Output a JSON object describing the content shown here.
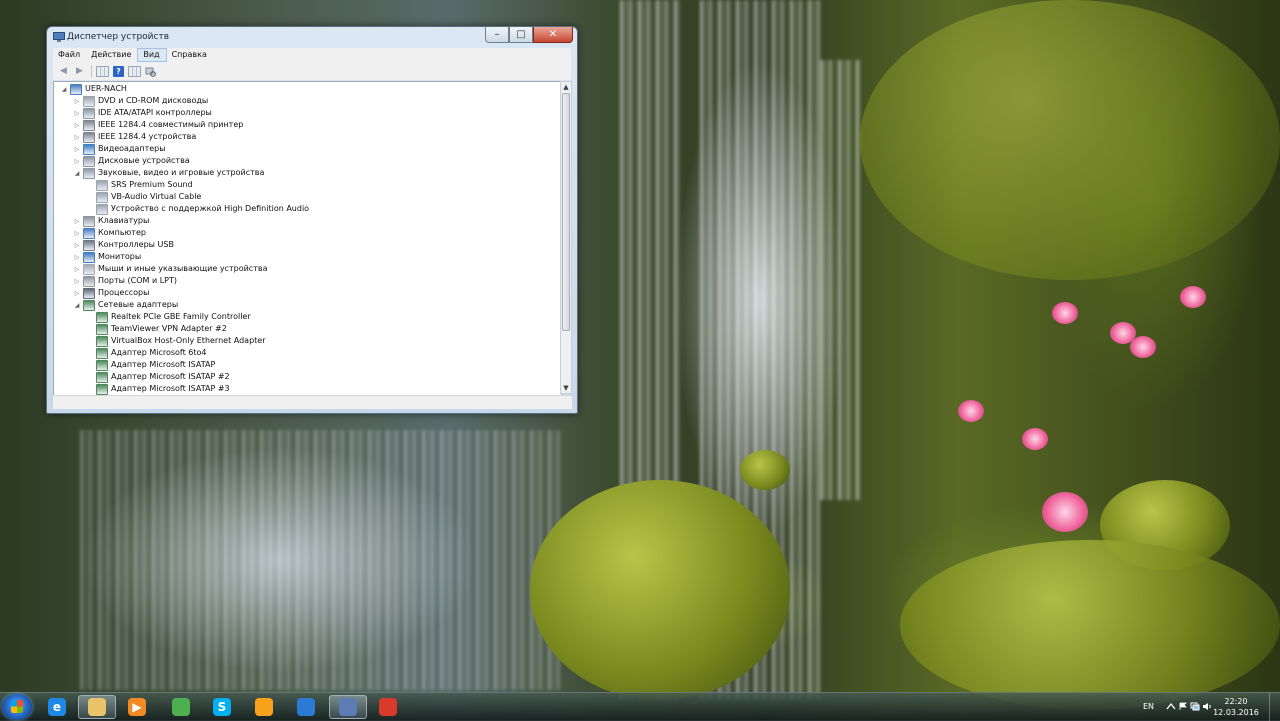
{
  "window": {
    "title": "Диспетчер устройств",
    "buttons": {
      "minimize": "–",
      "maximize": "□",
      "close": "✕"
    }
  },
  "menu": {
    "items": [
      {
        "label": "Файл"
      },
      {
        "label": "Действие"
      },
      {
        "label": "Вид"
      },
      {
        "label": "Справка"
      }
    ],
    "highlighted": "Вид"
  },
  "toolbar": {
    "buttons": [
      "back-arrow-icon",
      "forward-arrow-icon",
      "properties-grid-icon",
      "help-icon",
      "view-grid-icon",
      "scan-hardware-icon"
    ],
    "help_glyph": "?"
  },
  "tree": {
    "expander_glyphs": {
      "collapsed": "▷",
      "expanded": "◢"
    },
    "items": [
      {
        "label": "UER-NACH",
        "level": 0,
        "expander": "expanded",
        "icon": "computer-icon",
        "color": "#4a7fc1"
      },
      {
        "label": "DVD и CD-ROM дисководы",
        "level": 1,
        "expander": "collapsed",
        "icon": "dvd-drive-icon",
        "color": "#9aa3ad"
      },
      {
        "label": "IDE ATA/ATAPI контроллеры",
        "level": 1,
        "expander": "collapsed",
        "icon": "ide-controller-icon",
        "color": "#8a96a3"
      },
      {
        "label": "IEEE 1284.4 совместимый принтер",
        "level": 1,
        "expander": "collapsed",
        "icon": "printer-icon",
        "color": "#7d858e"
      },
      {
        "label": "IEEE 1284.4 устройства",
        "level": 1,
        "expander": "collapsed",
        "icon": "printer-icon",
        "color": "#7d858e"
      },
      {
        "label": "Видеоадаптеры",
        "level": 1,
        "expander": "collapsed",
        "icon": "display-adapter-icon",
        "color": "#3f7dc4"
      },
      {
        "label": "Дисковые устройства",
        "level": 1,
        "expander": "collapsed",
        "icon": "disk-drive-icon",
        "color": "#8d96a0"
      },
      {
        "label": "Звуковые, видео и игровые устройства",
        "level": 1,
        "expander": "expanded",
        "icon": "sound-icon",
        "color": "#8e9aa6"
      },
      {
        "label": "SRS Premium Sound",
        "level": 2,
        "expander": "none",
        "icon": "speaker-icon",
        "color": "#9aa5b1"
      },
      {
        "label": "VB-Audio Virtual Cable",
        "level": 2,
        "expander": "none",
        "icon": "speaker-icon",
        "color": "#9aa5b1"
      },
      {
        "label": "Устройство с поддержкой High Definition Audio",
        "level": 2,
        "expander": "none",
        "icon": "speaker-icon",
        "color": "#9aa5b1"
      },
      {
        "label": "Клавиатуры",
        "level": 1,
        "expander": "collapsed",
        "icon": "keyboard-icon",
        "color": "#8c949c"
      },
      {
        "label": "Компьютер",
        "level": 1,
        "expander": "collapsed",
        "icon": "computer-icon",
        "color": "#4a7fc1"
      },
      {
        "label": "Контроллеры USB",
        "level": 1,
        "expander": "collapsed",
        "icon": "usb-icon",
        "color": "#6f7b87"
      },
      {
        "label": "Мониторы",
        "level": 1,
        "expander": "collapsed",
        "icon": "monitor-icon",
        "color": "#3f7dc4"
      },
      {
        "label": "Мыши и иные указывающие устройства",
        "level": 1,
        "expander": "collapsed",
        "icon": "mouse-icon",
        "color": "#a3abb3"
      },
      {
        "label": "Порты (COM и LPT)",
        "level": 1,
        "expander": "collapsed",
        "icon": "port-icon",
        "color": "#8f979f"
      },
      {
        "label": "Процессоры",
        "level": 1,
        "expander": "collapsed",
        "icon": "processor-icon",
        "color": "#5f6b77"
      },
      {
        "label": "Сетевые адаптеры",
        "level": 1,
        "expander": "expanded",
        "icon": "network-adapter-icon",
        "color": "#4f8a5a"
      },
      {
        "label": "Realtek PCIe GBE Family Controller",
        "level": 2,
        "expander": "none",
        "icon": "network-adapter-icon",
        "color": "#4f8a5a"
      },
      {
        "label": "TeamViewer VPN Adapter #2",
        "level": 2,
        "expander": "none",
        "icon": "network-adapter-icon",
        "color": "#4f8a5a"
      },
      {
        "label": "VirtualBox Host-Only Ethernet Adapter",
        "level": 2,
        "expander": "none",
        "icon": "network-adapter-icon",
        "color": "#4f8a5a"
      },
      {
        "label": "Адаптер Microsoft 6to4",
        "level": 2,
        "expander": "none",
        "icon": "network-adapter-icon",
        "color": "#4f8a5a"
      },
      {
        "label": "Адаптер Microsoft ISATAP",
        "level": 2,
        "expander": "none",
        "icon": "network-adapter-icon",
        "color": "#4f8a5a"
      },
      {
        "label": "Адаптер Microsoft ISATAP #2",
        "level": 2,
        "expander": "none",
        "icon": "network-adapter-icon",
        "color": "#4f8a5a"
      },
      {
        "label": "Адаптер Microsoft ISATAP #3",
        "level": 2,
        "expander": "none",
        "icon": "network-adapter-icon",
        "color": "#4f8a5a"
      }
    ],
    "scrollbar": {
      "up": "▲",
      "down": "▼"
    }
  },
  "taskbar": {
    "start": "windows-start-orb",
    "apps": [
      {
        "name": "internet-explorer-icon",
        "color": "#1e88e5",
        "glyph": "e",
        "active": false
      },
      {
        "name": "file-explorer-icon",
        "color": "#e9c46a",
        "glyph": "",
        "active": true
      },
      {
        "name": "media-player-icon",
        "color": "#f08a24",
        "glyph": "▶",
        "active": false
      },
      {
        "name": "chrome-icon",
        "color": "#4caf50",
        "glyph": "",
        "active": false
      },
      {
        "name": "skype-icon",
        "color": "#00aff0",
        "glyph": "S",
        "active": false
      },
      {
        "name": "app-orange-icon",
        "color": "#f7a21b",
        "glyph": "",
        "active": false
      },
      {
        "name": "network-globe-icon",
        "color": "#2b7bd6",
        "glyph": "",
        "active": false
      },
      {
        "name": "device-manager-icon",
        "color": "#5b7db3",
        "glyph": "",
        "active": true
      },
      {
        "name": "presentation-icon",
        "color": "#d83b2b",
        "glyph": "",
        "active": false
      }
    ],
    "tray": {
      "language": "EN",
      "time": "22:20",
      "date": "12.03.2016"
    }
  }
}
